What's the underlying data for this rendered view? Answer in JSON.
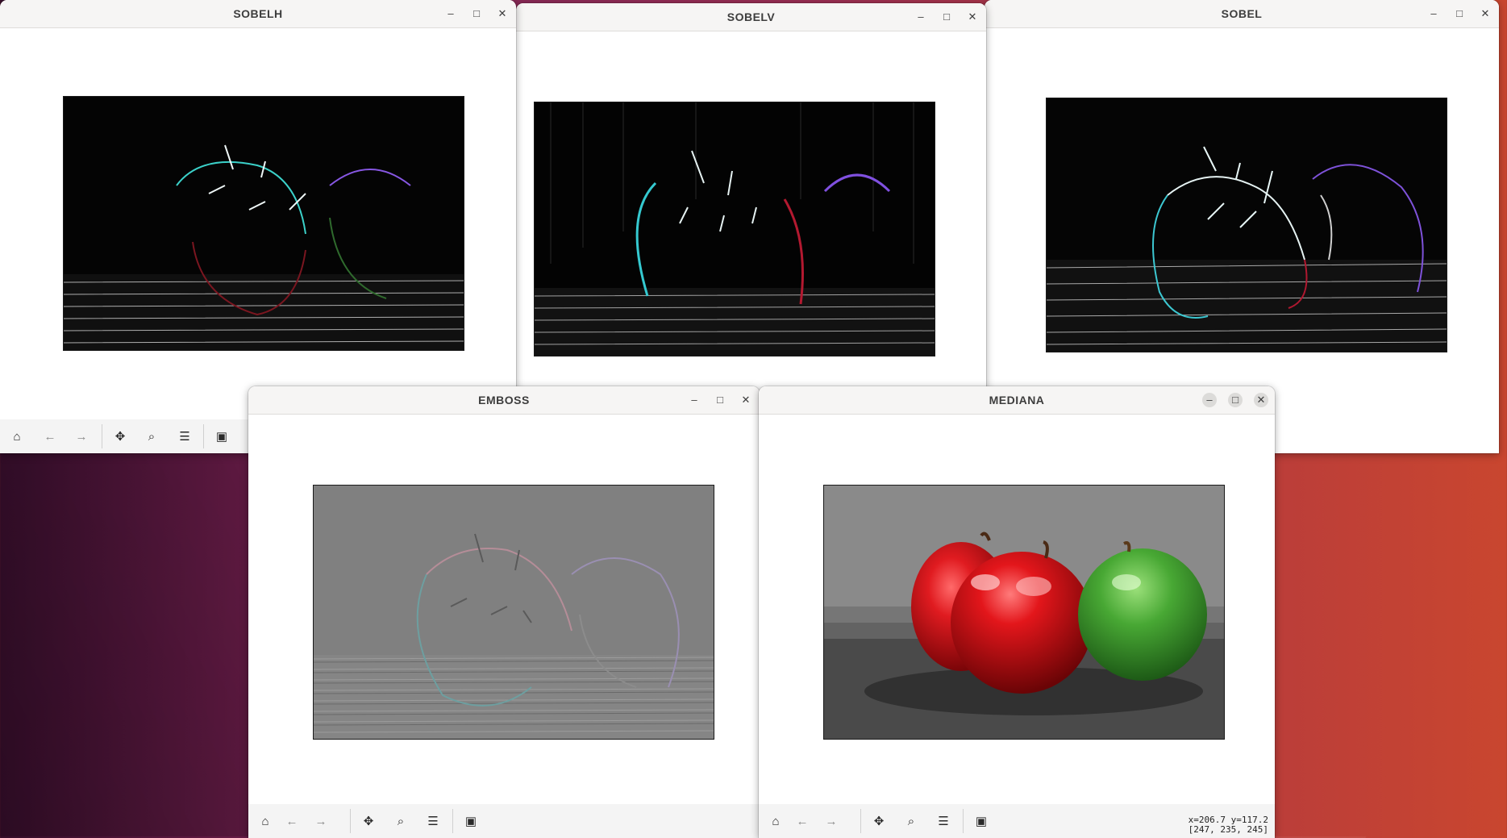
{
  "windows": [
    {
      "id": "sobelh",
      "title": "SOBELH"
    },
    {
      "id": "sobelv",
      "title": "SOBELV"
    },
    {
      "id": "sobel",
      "title": "SOBEL"
    },
    {
      "id": "emboss",
      "title": "EMBOSS"
    },
    {
      "id": "mediana",
      "title": "MEDIANA"
    }
  ],
  "window_controls": {
    "minimize": "–",
    "maximize": "□",
    "close": "✕"
  },
  "toolbar_icons": {
    "home": "⌂",
    "back": "←",
    "forward": "→",
    "pan": "✥",
    "zoom": "⌕",
    "configure": "☰",
    "save": "▣"
  },
  "mediana_readout": {
    "coords": "x=206.7 y=117.2",
    "rgb": "[247, 235, 245]"
  },
  "colors": {
    "desktop_left": "#3a0f2e",
    "desktop_right": "#c9462f",
    "titlebar": "#f6f5f4",
    "toolbar": "#f4f4f4",
    "apple_red": "#d3121a",
    "apple_green": "#4aa52e"
  }
}
